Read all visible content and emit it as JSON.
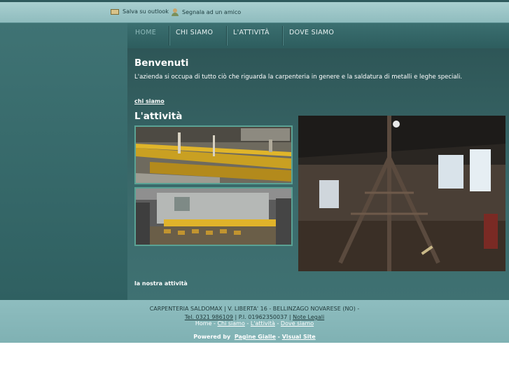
{
  "topbar": {
    "save_label": "Salva su outlook",
    "save_icon": "outlook-icon",
    "report_label": "Segnala ad un amico",
    "report_icon": "friend-icon"
  },
  "nav": {
    "items": [
      {
        "label": "HOME",
        "active": true
      },
      {
        "label": "CHI SIAMO",
        "active": false
      },
      {
        "label": "L'ATTIVITÀ",
        "active": false
      },
      {
        "label": "DOVE SIAMO",
        "active": false
      }
    ]
  },
  "content": {
    "welcome_title": "Benvenuti",
    "welcome_text": "L'azienda si occupa di tutto ciò che riguarda la carpenteria in genere e la saldatura di metalli e leghe speciali.",
    "link_chi_siamo": "chi siamo",
    "activity_title": "L'attività",
    "link_nostra_attivita": "la nostra attività"
  },
  "footer": {
    "company": "CARPENTERIA SALDOMAX | V. LIBERTA' 16 - BELLINZAGO NOVARESE (NO) -",
    "phone": "Tel. 0321 986109",
    "sep1": " | P.I. 01962350037 | ",
    "legal": "Note Legali",
    "nav": {
      "home": "Home",
      "dash": " - ",
      "chi_siamo": "Chi siamo",
      "attivita": "L'attività",
      "dove_siamo": "Dove siamo"
    },
    "powered_by": "Powered by",
    "pagine_gialle": "Pagine Gialle",
    "dash": " - ",
    "visual_site": "Visual Site"
  },
  "colors": {
    "main_bg": "#3a6a6b",
    "topbar_bg": "#a9cfd0",
    "footer_bg": "#8ebdbf",
    "photo_border": "#5aa294"
  }
}
